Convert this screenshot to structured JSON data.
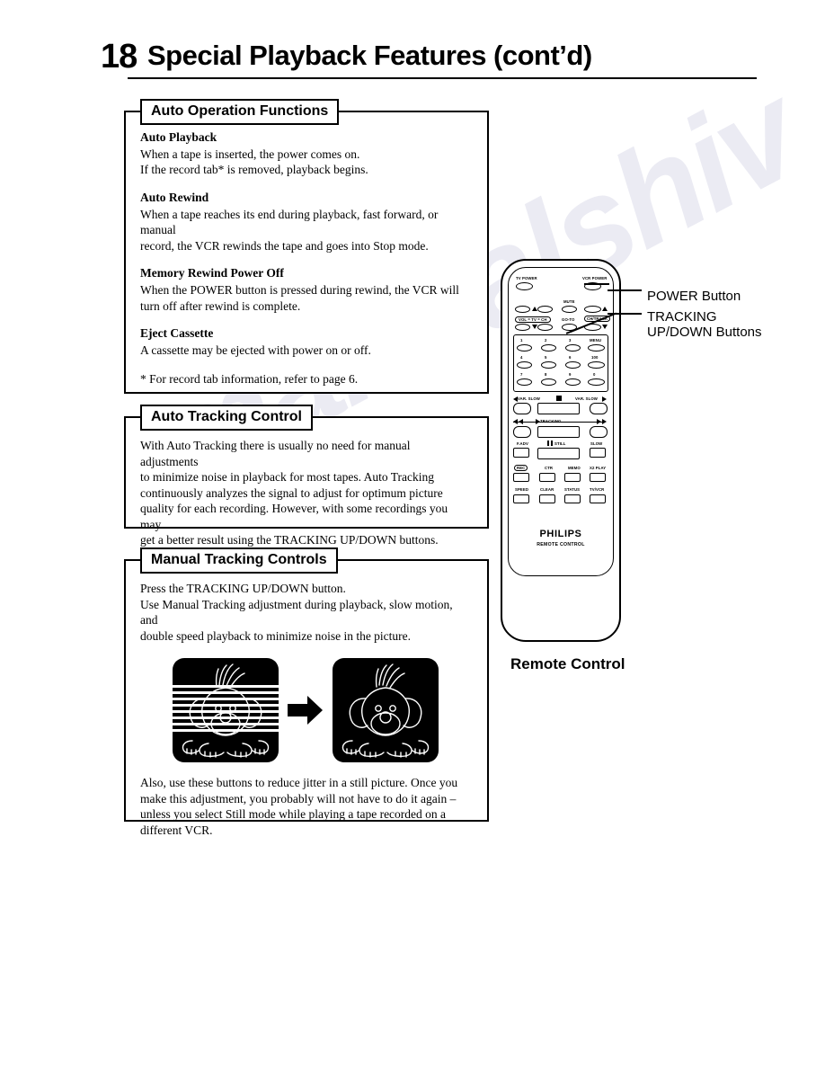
{
  "document": {
    "page_number": "18",
    "title": "Special Playback Features (cont’d)",
    "watermark": "manualshiv"
  },
  "panels": [
    {
      "id": "auto-operation-functions",
      "title": "Auto Operation Functions",
      "sections": [
        {
          "heading": "Auto Playback",
          "lines": [
            "When a tape is inserted, the power comes on.",
            "If the record tab* is removed, playback begins."
          ]
        },
        {
          "heading": "Auto Rewind",
          "lines": [
            "When a tape reaches its end during playback, fast forward, or manual",
            "record, the VCR rewinds the tape and goes into Stop mode."
          ]
        },
        {
          "heading": "Memory Rewind Power Off",
          "lines": [
            "When the POWER button is pressed during rewind, the VCR will",
            "turn off after rewind is complete."
          ]
        },
        {
          "heading": "Eject Cassette",
          "lines": [
            "A cassette may be ejected with power on or off."
          ]
        }
      ],
      "footnote": "* For record tab information, refer to page 6."
    },
    {
      "id": "auto-tracking-control",
      "title": "Auto Tracking Control",
      "body": [
        "With Auto Tracking there is usually no need for manual adjustments",
        "to minimize noise in playback for most tapes. Auto Tracking",
        "continuously analyzes the signal to adjust for optimum picture",
        "quality for each recording. However, with some recordings you may",
        "get a better result using the TRACKING UP/DOWN buttons."
      ]
    },
    {
      "id": "manual-tracking-controls",
      "title": "Manual Tracking Controls",
      "body_top": [
        "Press the TRACKING UP/DOWN button.",
        "Use Manual Tracking adjustment during playback, slow motion, and",
        "double speed playback to minimize noise in the picture."
      ],
      "figure": {
        "left_caption": "noisy-picture",
        "arrow": "right-arrow",
        "right_caption": "clean-picture"
      },
      "body_bottom": [
        "Also, use these buttons to reduce jitter in a still picture. Once you",
        "make this adjustment, you probably will not have to do it again –",
        "unless you select Still mode while playing a tape recorded on a",
        "different VCR."
      ]
    }
  ],
  "remote": {
    "caption": "Remote Control",
    "brand": "PHILIPS",
    "brand_sub": "REMOTE CONTROL",
    "labels": {
      "tv_power": "TV POWER",
      "vcr_power": "VCR POWER",
      "mute": "MUTE",
      "vol_tv_ch": "VOL = TV = CH",
      "go_to": "GO-TO",
      "trackch": "CH/TRACK",
      "menu": "MENU",
      "hundred": "100",
      "var_slow_left": "VAR. SLOW",
      "var_slow_right": "VAR. SLOW",
      "tracking": "TRACKING",
      "f_adv": "F.ADV",
      "still": "STILL",
      "slow": "SLOW",
      "ctr": "CTR",
      "memo": "MEMO",
      "x2_play": "X2 PLAY",
      "speed": "SPEED",
      "clear": "CLEAR",
      "status": "STATUS",
      "tv_vcr": "TV/VCR"
    },
    "keypad": [
      "1",
      "2",
      "3",
      "MENU",
      "4",
      "5",
      "6",
      "100",
      "7",
      "8",
      "9",
      "0"
    ]
  },
  "callouts": [
    {
      "id": "power-button",
      "text": "POWER Button"
    },
    {
      "id": "tracking-buttons",
      "text": "TRACKING\nUP/DOWN Buttons"
    }
  ]
}
